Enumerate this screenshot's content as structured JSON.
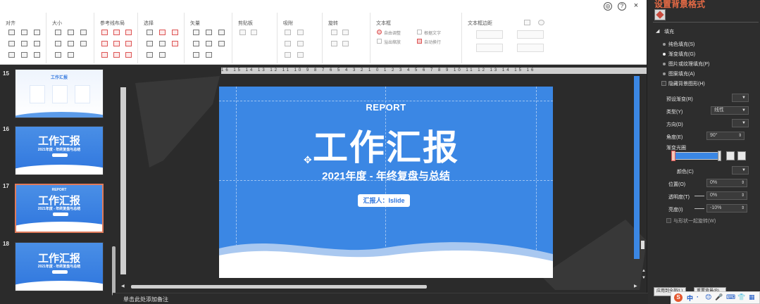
{
  "ribbon": {
    "groups": [
      {
        "title": "对齐"
      },
      {
        "title": "大小"
      },
      {
        "title": "参考线布局"
      },
      {
        "title": "选择"
      },
      {
        "title": "矢量"
      },
      {
        "title": "剪贴板"
      },
      {
        "title": "吸附"
      },
      {
        "title": "旋转"
      },
      {
        "title": "文本框"
      },
      {
        "title": "文本框边距"
      }
    ],
    "textbox_options": {
      "free_adjust": "自由调整",
      "by_text": "根据文字",
      "overflow_shrink": "溢出缩放",
      "auto_wrap": "自动换行"
    },
    "top_icons": [
      "target-icon",
      "help-icon",
      "close-icon"
    ]
  },
  "pane": {
    "title": "设置背景格式",
    "section_fill": "填充",
    "fill_options": [
      {
        "label": "纯色填充(S)",
        "selected": false
      },
      {
        "label": "渐变填充(G)",
        "selected": true
      },
      {
        "label": "图片或纹理填充(P)",
        "selected": false
      },
      {
        "label": "图案填充(A)",
        "selected": false
      }
    ],
    "hide_bg": "隐藏背景图形(H)",
    "preset_label": "预设渐变(R)",
    "type_label": "类型(Y)",
    "type_value": "线性",
    "direction_label": "方向(D)",
    "angle_label": "角度(E)",
    "angle_value": "90°",
    "stops_label": "渐变光圈",
    "color_label": "颜色(C)",
    "position_label": "位置(O)",
    "position_value": "0%",
    "transparency_label": "透明度(T)",
    "transparency_value": "0%",
    "brightness_label": "亮度(I)",
    "brightness_value": "-10%",
    "rotate_with_shape": "与形状一起旋转(W)",
    "apply_all": "应用到全部(L)",
    "reset_bg": "重置背景(B)"
  },
  "slides": {
    "items": [
      {
        "num": "15",
        "title": "工作汇报"
      },
      {
        "num": "16",
        "title": "工作汇报",
        "subtitle": "2021年度 - 年终复盘与总结"
      },
      {
        "num": "17",
        "title": "工作汇报",
        "subtitle": "2021年度 - 年终复盘与总结",
        "top": "REPORT",
        "selected": true
      },
      {
        "num": "18",
        "title": "工作汇报",
        "subtitle": "2021年度 - 年终复盘与总结"
      }
    ]
  },
  "ruler_text": "16 15 14 13 12 11 10 9 8 7 6 5 4 3 2 1 0 1 2 3 4 5 6 7 8 9 10 11 12 13 14 15 16",
  "slide": {
    "report": "REPORT",
    "title": "工作汇报",
    "subtitle": "2021年度 - 年终复盘与总结",
    "reporter": "汇报人：Islide",
    "bg_color": "#3b87e4"
  },
  "status": {
    "notes": "单击此处添加备注"
  },
  "tray": {
    "items": [
      "S",
      "中",
      "·",
      "😊",
      "🎤",
      "⌨",
      "👕",
      "▦"
    ]
  }
}
